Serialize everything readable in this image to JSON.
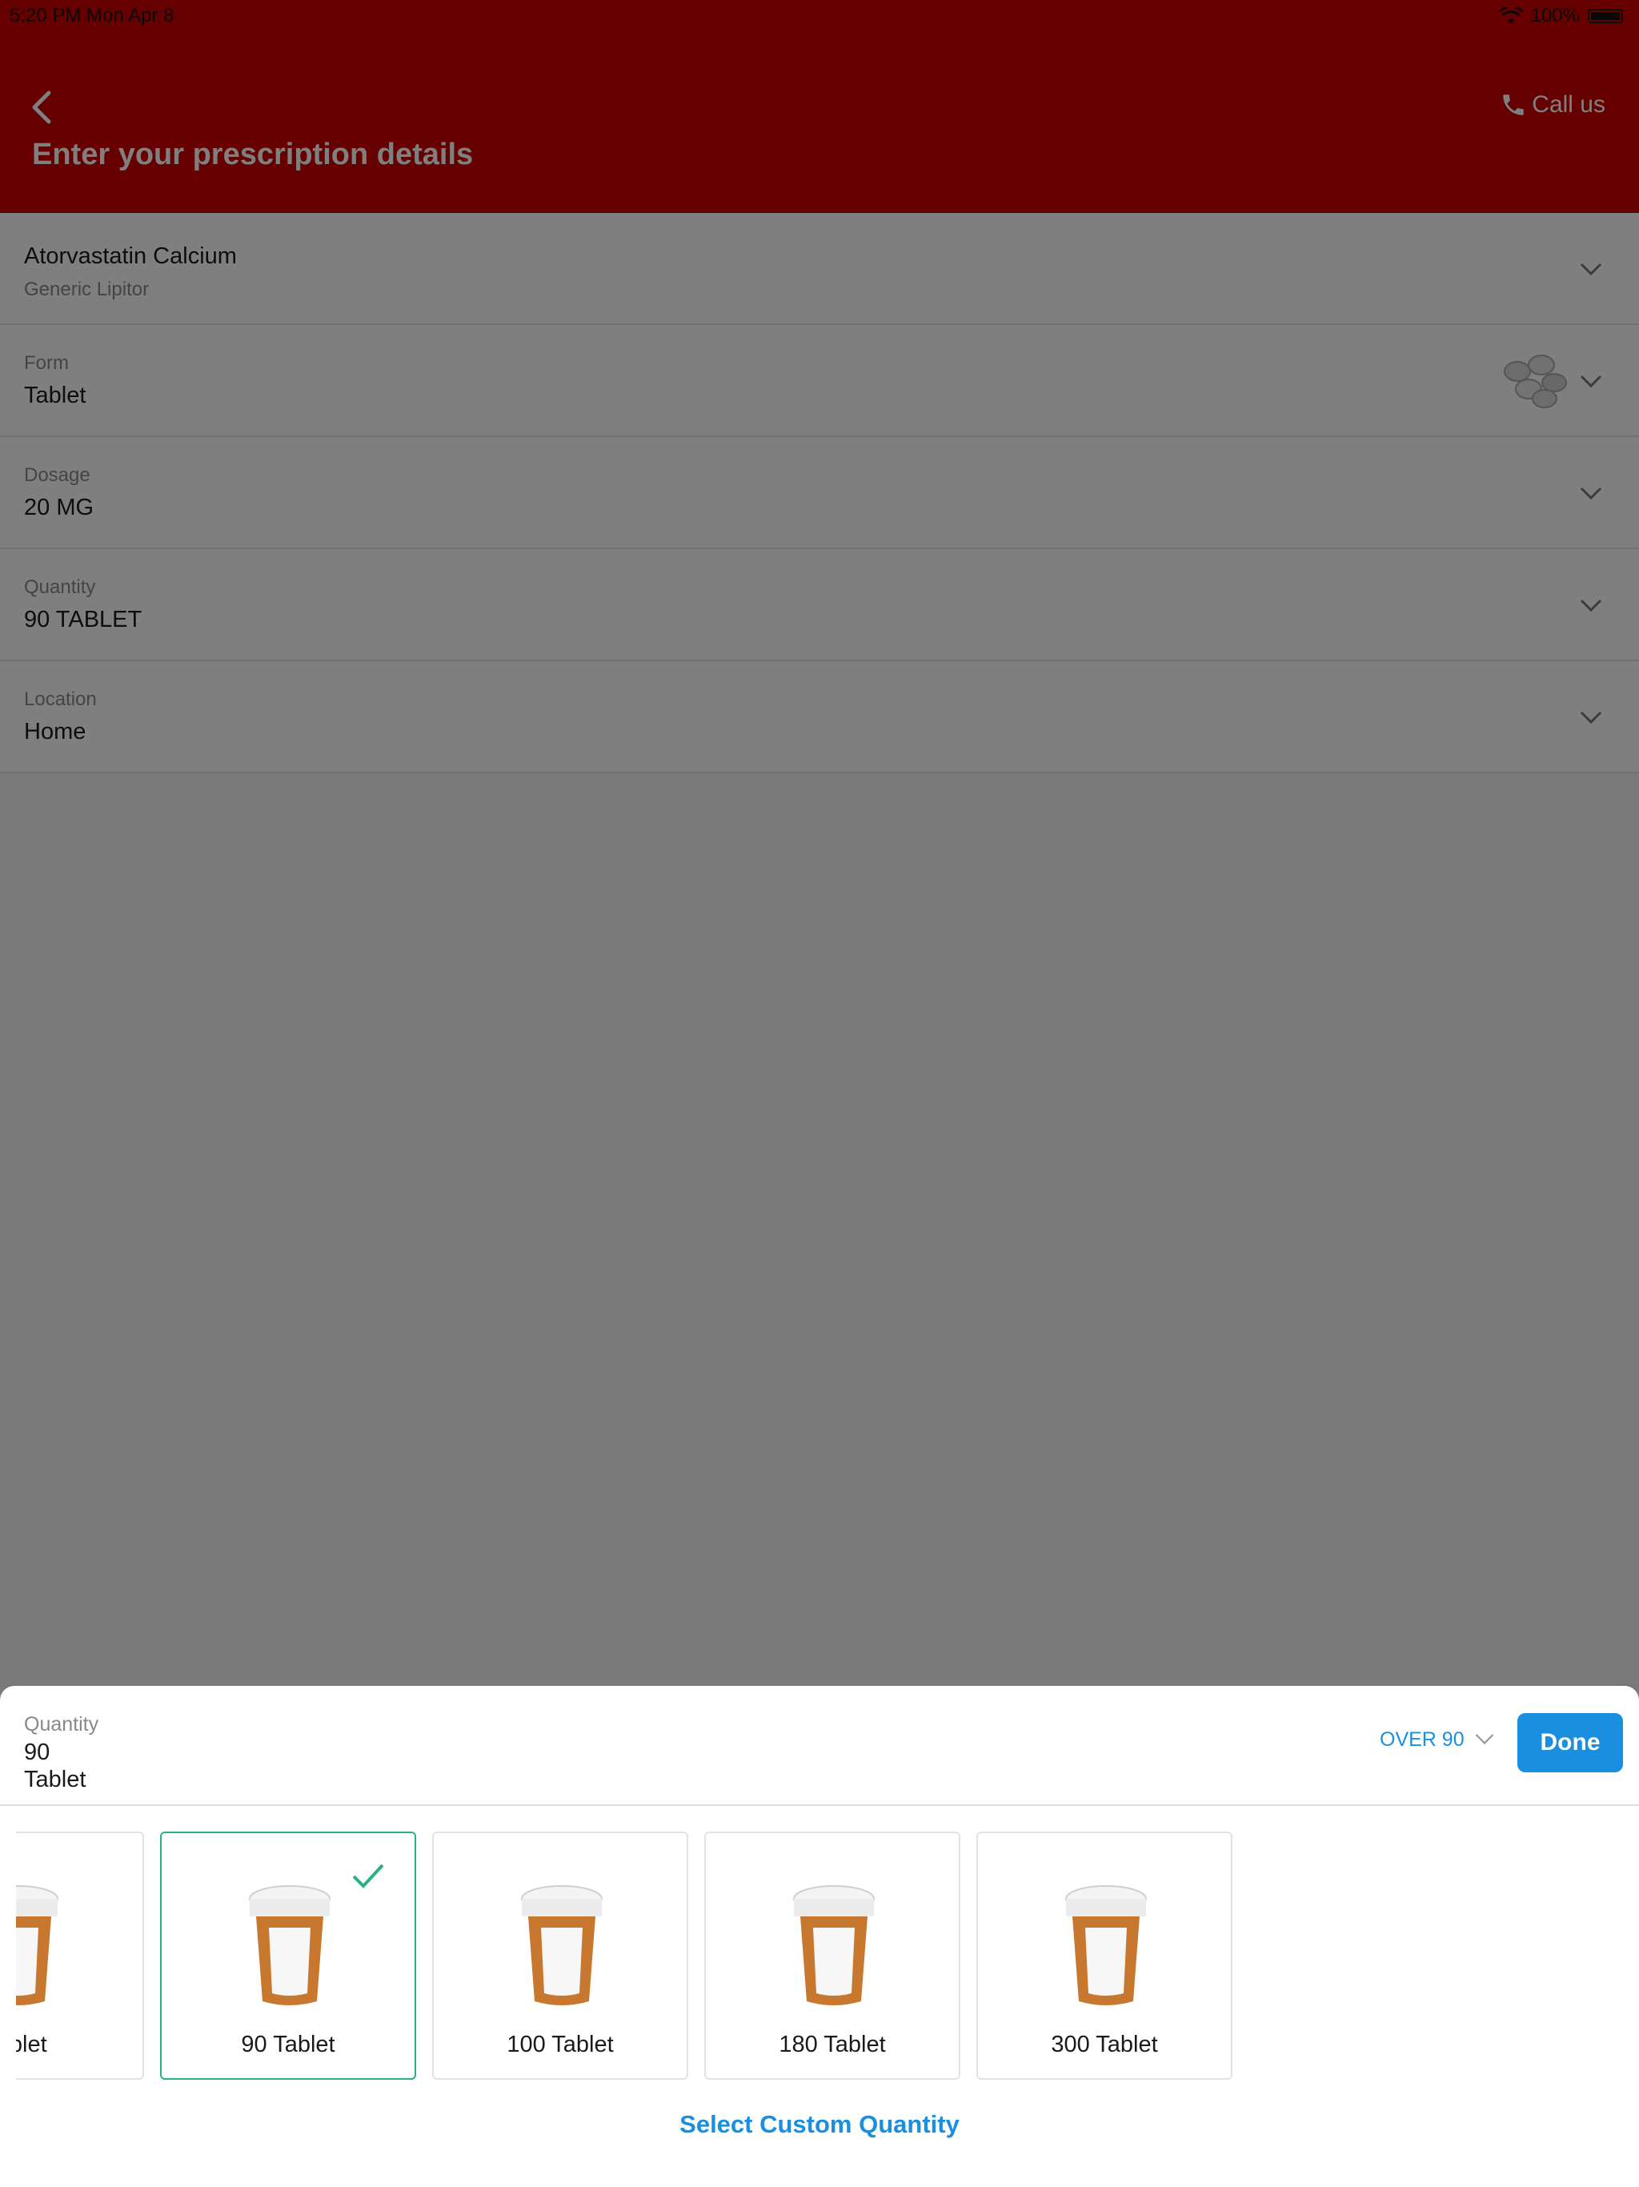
{
  "status_bar": {
    "time": "5:20 PM   Mon Apr 8",
    "battery": "100%"
  },
  "header": {
    "title": "Enter your prescription details",
    "call_label": "Call us"
  },
  "form": {
    "drug": {
      "name": "Atorvastatin Calcium",
      "subtitle": "Generic Lipitor"
    },
    "form_row": {
      "label": "Form",
      "value": "Tablet"
    },
    "dosage": {
      "label": "Dosage",
      "value": "20 MG"
    },
    "quantity": {
      "label": "Quantity",
      "value": "90 TABLET"
    },
    "location": {
      "label": "Location",
      "value": "Home"
    }
  },
  "sheet": {
    "label": "Quantity",
    "value_number": "90",
    "value_unit": "Tablet",
    "over_label": "OVER 90",
    "done_label": "Done",
    "options": [
      {
        "label": "Tablet",
        "selected": false
      },
      {
        "label": "90 Tablet",
        "selected": true
      },
      {
        "label": "100 Tablet",
        "selected": false
      },
      {
        "label": "180 Tablet",
        "selected": false
      },
      {
        "label": "300 Tablet",
        "selected": false
      }
    ],
    "custom_label": "Select Custom Quantity"
  },
  "colors": {
    "brand_red": "#cc0000",
    "accent_blue": "#1a8fe0",
    "selected_green": "#2bb07f"
  }
}
